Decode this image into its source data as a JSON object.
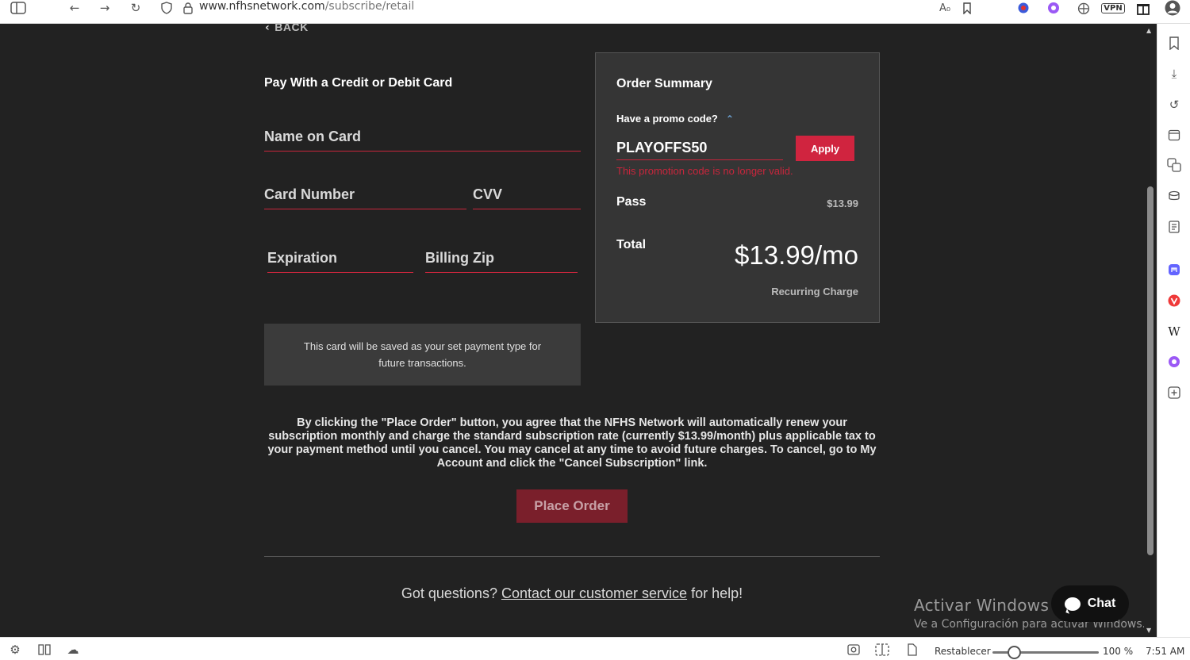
{
  "browser": {
    "url_domain": "www.nfhsnetwork.com",
    "url_path": "/subscribe/retail",
    "icons": [
      "sidebar-toggle-icon",
      "back-arrow-icon",
      "forward-arrow-icon",
      "reload-icon",
      "shield-icon",
      "lock-icon",
      "read-aloud-icon",
      "bookmark-icon",
      "extension-icon",
      "copilot-icon",
      "puzzle-icon",
      "vpn-icon",
      "gift-icon",
      "profile-icon"
    ],
    "vpn_label": "VPN"
  },
  "right_sidebar": {
    "icons": [
      "bookmarks-icon",
      "downloads-icon",
      "history-icon",
      "calendar-icon",
      "translate-icon",
      "drinks-icon",
      "notes-icon",
      "mastodon-icon",
      "vivaldi-icon",
      "wikipedia-icon",
      "copilot-icon",
      "add-panel-icon"
    ],
    "wiki_glyph": "W"
  },
  "status_bar": {
    "reset_label": "Restablecer",
    "zoom": "100 %",
    "zoom_fraction": 0.25,
    "time": "7:51 AM"
  },
  "page": {
    "back_label": "BACK",
    "pay_title": "Pay With a Credit or Debit Card",
    "fields": {
      "name_on_card": "Name on Card",
      "card_number": "Card Number",
      "cvv": "CVV",
      "expiration": "Expiration",
      "billing_zip": "Billing Zip"
    },
    "save_note": "This card will be saved as your set payment type for future transactions.",
    "order_summary": {
      "title": "Order Summary",
      "promo_question": "Have a promo code?",
      "promo_value": "PLAYOFFS50",
      "apply_label": "Apply",
      "promo_error": "This promotion code is no longer valid.",
      "pass_label": "Pass",
      "pass_price": "$13.99",
      "total_label": "Total",
      "total_price": "$13.99/mo",
      "recurring_label": "Recurring Charge"
    },
    "terms": "By clicking the \"Place Order\" button, you agree that the NFHS Network will automatically renew your subscription monthly and charge the standard subscription rate (currently $13.99/month) plus applicable tax to your payment method until you cancel. You may cancel at any time to avoid future charges. To cancel, go to My Account and click the \"Cancel Subscription\" link.",
    "place_order_label": "Place Order",
    "questions_prefix": "Got questions?",
    "questions_link": "Contact our customer service",
    "questions_suffix": "for help!",
    "chat_label": "Chat"
  },
  "watermark": {
    "line1": "Activar Windows",
    "line2": "Ve a Configuración para activar Windows."
  },
  "colors": {
    "accent": "#d0243f",
    "background": "#222222",
    "panel": "#353535"
  }
}
